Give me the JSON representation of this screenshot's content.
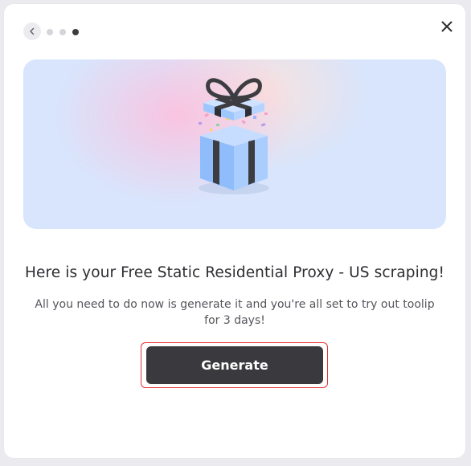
{
  "stepper": {
    "total": 3,
    "current": 3
  },
  "icons": {
    "back": "chevron-left-icon",
    "close": "close-icon",
    "hero": "gift-box-icon"
  },
  "content": {
    "title": "Here is your Free Static Residential Proxy - US scraping!",
    "subtitle": "All you need to do now is generate it and you're all set to try out toolip for 3 days!"
  },
  "actions": {
    "generate_label": "Generate"
  },
  "colors": {
    "button_bg": "#3a3a3e",
    "highlight_outline": "#e53238",
    "hero_bg": "#d8e5fc",
    "gift_blue": "#9ec7ff"
  }
}
